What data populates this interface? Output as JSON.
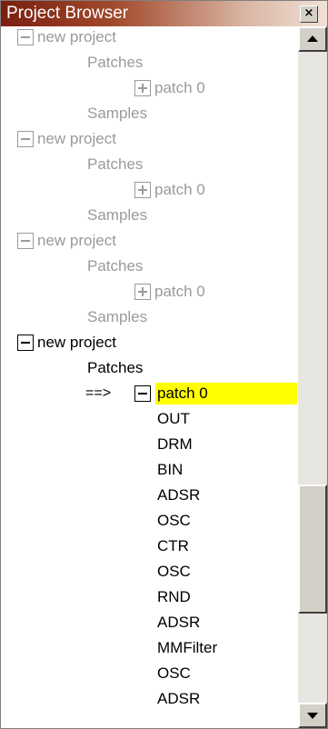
{
  "window": {
    "title": "Project Browser",
    "close_label": "×"
  },
  "tree": {
    "projects": [
      {
        "name": "new project",
        "state": "dim",
        "patches_label": "Patches",
        "patches": [
          {
            "name": "patch 0",
            "expanded": false
          }
        ],
        "samples_label": "Samples"
      },
      {
        "name": "new project",
        "state": "dim",
        "patches_label": "Patches",
        "patches": [
          {
            "name": "patch 0",
            "expanded": false
          }
        ],
        "samples_label": "Samples"
      },
      {
        "name": "new project",
        "state": "dim",
        "patches_label": "Patches",
        "patches": [
          {
            "name": "patch 0",
            "expanded": false
          }
        ],
        "samples_label": "Samples"
      },
      {
        "name": "new project",
        "state": "active",
        "patches_label": "Patches",
        "current_marker": "==>",
        "patches": [
          {
            "name": "patch 0",
            "expanded": true,
            "selected": true,
            "modules": [
              "OUT",
              "DRM",
              "BIN",
              "ADSR",
              "OSC",
              "CTR",
              "OSC",
              "RND",
              "ADSR",
              "MMFilter",
              "OSC",
              "ADSR"
            ]
          }
        ]
      }
    ]
  },
  "colors": {
    "title_bar_start": "#7a1f10",
    "selected_highlight": "#ffff00",
    "dim_text": "#9a9a9a"
  },
  "icons": {
    "expanded": "minus-box-icon",
    "collapsed": "plus-box-icon",
    "close": "close-icon",
    "scroll_up": "arrow-up-icon",
    "scroll_down": "arrow-down-icon"
  }
}
